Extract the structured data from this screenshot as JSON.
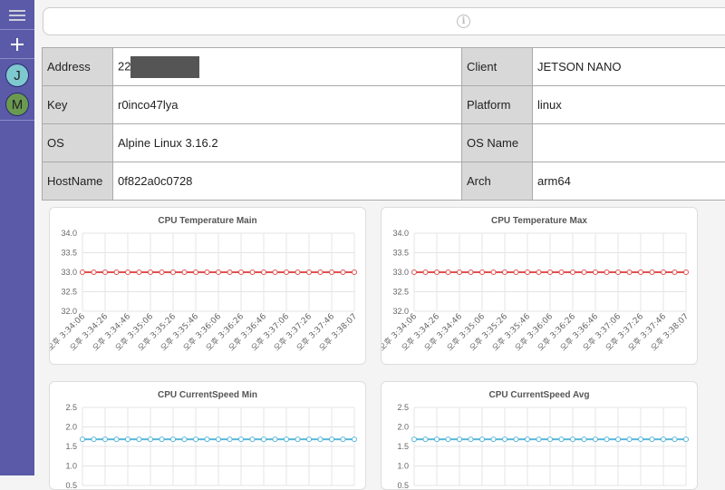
{
  "sidebar": {
    "menu_icon": "hamburger-icon",
    "add_icon": "plus-icon",
    "users": [
      {
        "initial": "J",
        "color": "#7ec8d0"
      },
      {
        "initial": "M",
        "color": "#6a9a50"
      }
    ]
  },
  "topbar": {
    "info_icon": "i"
  },
  "device_info": [
    {
      "label": "Address",
      "value": "22",
      "label2": "Client",
      "value2": "JETSON NANO"
    },
    {
      "label": "Key",
      "value": "r0inco47lya",
      "label2": "Platform",
      "value2": "linux"
    },
    {
      "label": "OS",
      "value": "Alpine Linux 3.16.2",
      "label2": "OS Name",
      "value2": ""
    },
    {
      "label": "HostName",
      "value": "0f822a0c0728",
      "label2": "Arch",
      "value2": "arm64"
    }
  ],
  "chart_data": [
    {
      "type": "line",
      "title": "CPU Temperature Main",
      "color": "#e05050",
      "x": [
        "오후 3:34:06",
        "오후 3:34:26",
        "오후 3:34:46",
        "오후 3:35:06",
        "오후 3:35:26",
        "오후 3:35:46",
        "오후 3:36:06",
        "오후 3:36:26",
        "오후 3:36:46",
        "오후 3:37:06",
        "오후 3:37:26",
        "오후 3:37:46",
        "오후 3:38:07"
      ],
      "y": [
        33,
        33,
        33,
        33,
        33,
        33,
        33,
        33,
        33,
        33,
        33,
        33,
        33,
        33,
        33,
        33,
        33,
        33,
        33,
        33,
        33,
        33,
        33,
        33,
        33
      ],
      "yticks": [
        "34.0",
        "33.5",
        "33.0",
        "32.5",
        "32.0"
      ],
      "ylim": [
        32,
        34
      ]
    },
    {
      "type": "line",
      "title": "CPU Temperature Max",
      "color": "#e05050",
      "x": [
        "오후 3:34:06",
        "오후 3:34:26",
        "오후 3:34:46",
        "오후 3:35:06",
        "오후 3:35:26",
        "오후 3:35:46",
        "오후 3:36:06",
        "오후 3:36:26",
        "오후 3:36:46",
        "오후 3:37:06",
        "오후 3:37:26",
        "오후 3:37:46",
        "오후 3:38:07"
      ],
      "y": [
        33,
        33,
        33,
        33,
        33,
        33,
        33,
        33,
        33,
        33,
        33,
        33,
        33,
        33,
        33,
        33,
        33,
        33,
        33,
        33,
        33,
        33,
        33,
        33,
        33
      ],
      "yticks": [
        "34.0",
        "33.5",
        "33.0",
        "32.5",
        "32.0"
      ],
      "ylim": [
        32,
        34
      ]
    },
    {
      "type": "line",
      "title": "CPU CurrentSpeed Min",
      "color": "#5ab8d8",
      "x": [],
      "y": [
        1.48,
        1.48,
        1.48,
        1.48,
        1.48,
        1.48,
        1.48,
        1.48,
        1.48,
        1.48,
        1.48,
        1.48,
        1.48,
        1.48,
        1.48,
        1.48,
        1.48,
        1.48,
        1.48,
        1.48,
        1.48,
        1.48,
        1.48,
        1.48,
        1.48
      ],
      "yticks": [
        "2.5",
        "2.0",
        "1.5",
        "1.0",
        "0.5"
      ],
      "ylim": [
        0,
        2.5
      ]
    },
    {
      "type": "line",
      "title": "CPU CurrentSpeed Avg",
      "color": "#5ab8d8",
      "x": [],
      "y": [
        1.48,
        1.48,
        1.48,
        1.48,
        1.48,
        1.48,
        1.48,
        1.48,
        1.48,
        1.48,
        1.48,
        1.48,
        1.48,
        1.48,
        1.48,
        1.48,
        1.48,
        1.48,
        1.48,
        1.48,
        1.48,
        1.48,
        1.48,
        1.48,
        1.48
      ],
      "yticks": [
        "2.5",
        "2.0",
        "1.5",
        "1.0",
        "0.5"
      ],
      "ylim": [
        0,
        2.5
      ]
    }
  ]
}
